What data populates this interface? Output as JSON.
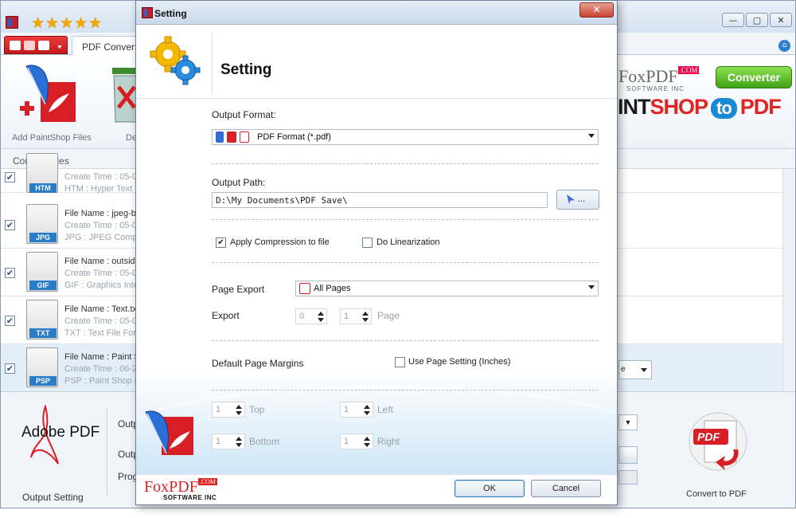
{
  "main": {
    "rating_stars": "★★★★★",
    "tab_label": "PDF Conversio",
    "ribbon": {
      "add_label": "Add PaintShop Files",
      "delete_label": "De"
    },
    "brand": {
      "foxpdf": "FoxPDF",
      "foxpdf_com": ".COM",
      "software_inc": "SOFTWARE INC",
      "converter": "Converter",
      "banner_a": "INT",
      "banner_b": "SHOP",
      "banner_to": "to",
      "banner_c": "PDF"
    },
    "convert_files_label": "Convert Files",
    "files": [
      {
        "ext": "HTM",
        "name": "",
        "created": "Create Time : 05-0",
        "type": "HTM : Hyper Text"
      },
      {
        "ext": "JPG",
        "name": "File Name : jpeg-bi",
        "created": "Create Time : 05-0",
        "type": "JPG : JPEG Compre"
      },
      {
        "ext": "GIF",
        "name": "File Name : outside",
        "created": "Create Time : 05-0",
        "type": "GIF : Graphics Inte"
      },
      {
        "ext": "TXT",
        "name": "File Name : Text.tx",
        "created": "Create Time : 05-0",
        "type": "TXT : Text File For"
      },
      {
        "ext": "PSP",
        "name": "File Name : Paint S",
        "created": "Create Time : 06-2",
        "type": "PSP : Paint Shop P"
      }
    ],
    "row_combo_text": "e",
    "bottom": {
      "adobe_pdf": "Adobe PDF",
      "output_setting": "Output Setting",
      "label_1": "Outp",
      "label_2": "Outp",
      "label_3": "Prog",
      "convert_to_pdf": "Convert to PDF"
    }
  },
  "dialog": {
    "title": "Setting",
    "close_glyph": "✕",
    "heading": "Setting",
    "output_format_label": "Output Format:",
    "output_format_value": "PDF Format (*.pdf)",
    "output_path_label": "Output Path:",
    "output_path_value": "D:\\My Documents\\PDF Save\\",
    "browse_dots": "...",
    "apply_compression": {
      "label": "Apply Compression to file",
      "checked": true
    },
    "do_linearization": {
      "label": "Do Linearization",
      "checked": false
    },
    "page_export_label": "Page Export",
    "page_export_value": "All Pages",
    "export_label": "Export",
    "export_from": "0",
    "export_to": "1",
    "page_label": "Page",
    "default_margins_label": "Default Page Margins",
    "use_page_setting": {
      "label": "Use Page Setting (Inches)",
      "checked": false
    },
    "margins": {
      "top": {
        "label": "Top",
        "value": "1"
      },
      "left": {
        "label": "Left",
        "value": "1"
      },
      "bottom": {
        "label": "Bottom",
        "value": "1"
      },
      "right": {
        "label": "Right",
        "value": "1"
      }
    },
    "ok_label": "OK",
    "cancel_label": "Cancel",
    "foxpdf_footer_fox": "FoxPDF",
    "foxpdf_footer_com": ".COM",
    "foxpdf_footer_sub": "SOFTWARE INC"
  },
  "colors": {
    "accent_red": "#c0202a",
    "accent_blue": "#2a7cc7",
    "dialog_border": "#6f7f95"
  }
}
